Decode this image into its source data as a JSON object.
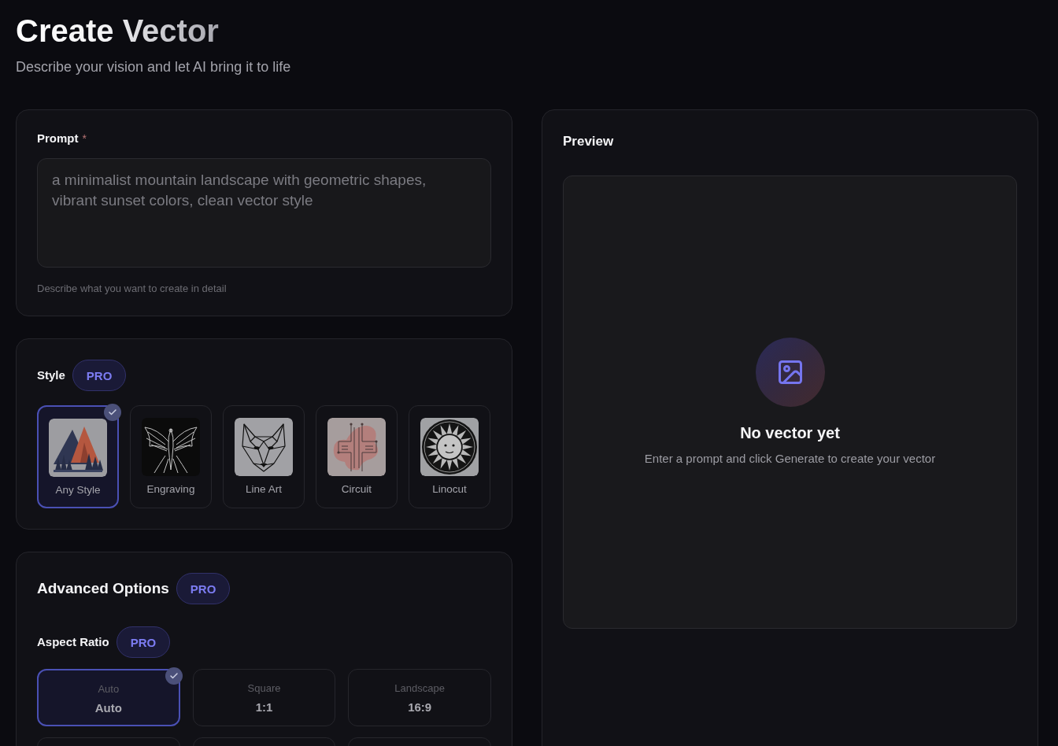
{
  "header": {
    "title": "Create Vector",
    "subtitle": "Describe your vision and let AI bring it to life"
  },
  "prompt": {
    "label": "Prompt",
    "required_mark": "*",
    "placeholder": "a minimalist mountain landscape with geometric shapes, vibrant sunset colors, clean vector style",
    "hint": "Describe what you want to create in detail"
  },
  "style": {
    "label": "Style",
    "badge": "PRO",
    "options": [
      {
        "label": "Any Style",
        "kind": "mountains",
        "selected": true
      },
      {
        "label": "Engraving",
        "kind": "bird",
        "selected": false
      },
      {
        "label": "Line Art",
        "kind": "wolf",
        "selected": false
      },
      {
        "label": "Circuit",
        "kind": "circuit",
        "selected": false
      },
      {
        "label": "Linocut",
        "kind": "sun",
        "selected": false
      }
    ]
  },
  "advanced_options": {
    "title": "Advanced Options",
    "badge": "PRO",
    "aspect_ratio": {
      "label": "Aspect Ratio",
      "badge": "PRO",
      "options": [
        {
          "name": "Auto",
          "ratio": "Auto",
          "selected": true
        },
        {
          "name": "Square",
          "ratio": "1:1",
          "selected": false
        },
        {
          "name": "Landscape",
          "ratio": "16:9",
          "selected": false
        },
        {
          "selected": false
        },
        {
          "selected": false
        },
        {
          "selected": false
        }
      ]
    }
  },
  "preview": {
    "title": "Preview",
    "empty_state": {
      "title": "No vector yet",
      "message": "Enter a prompt and click Generate to create your vector"
    }
  }
}
